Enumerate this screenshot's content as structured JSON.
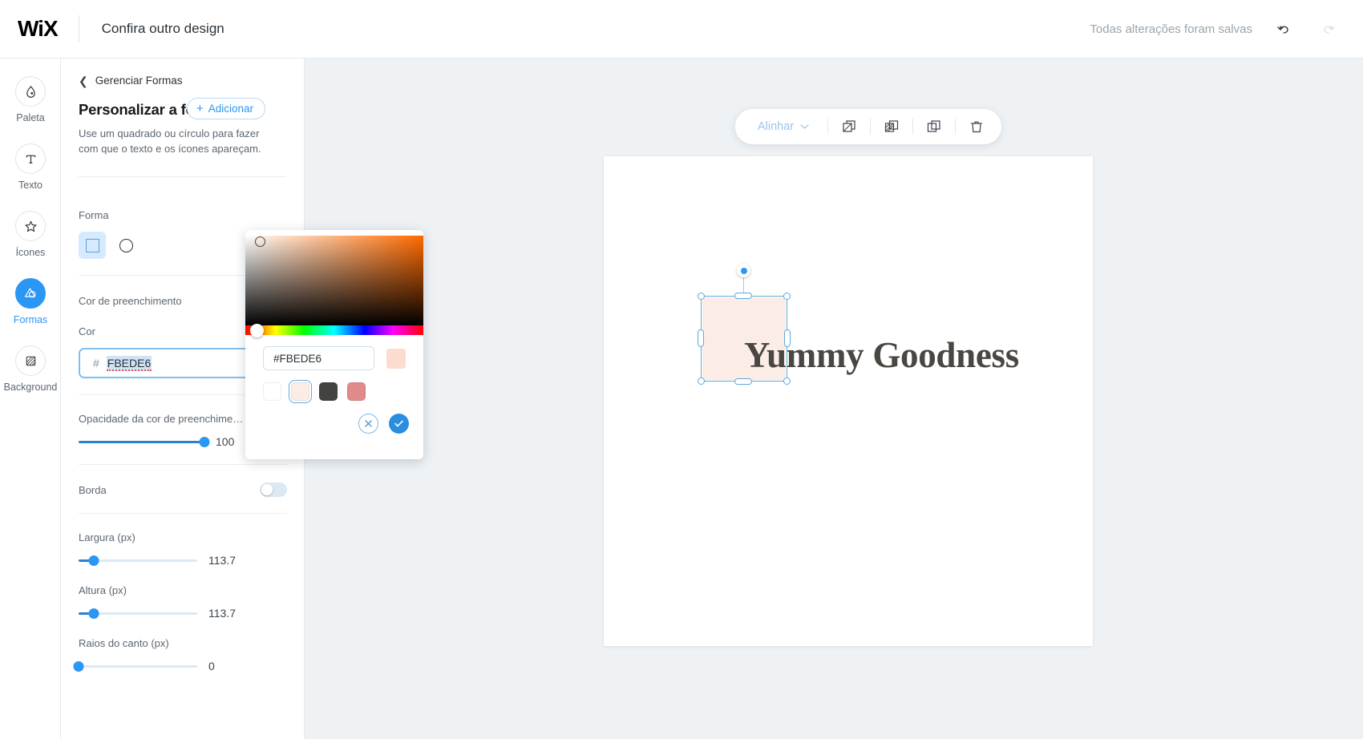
{
  "topbar": {
    "logo": "WiX",
    "title": "Confira outro design",
    "saved_status": "Todas alterações foram salvas",
    "undo_icon": "undo-icon",
    "redo_icon": "redo-icon"
  },
  "rail": {
    "items": [
      {
        "label": "Paleta",
        "icon": "droplet-icon",
        "active": false
      },
      {
        "label": "Texto",
        "icon": "text-t-icon",
        "active": false
      },
      {
        "label": "Ícones",
        "icon": "star-icon",
        "active": false
      },
      {
        "label": "Formas",
        "icon": "shapes-icon",
        "active": true
      },
      {
        "label": "Background",
        "icon": "hatched-square-icon",
        "active": false
      }
    ]
  },
  "panel": {
    "back_label": "Gerenciar Formas",
    "back_icon": "chevron-left-icon",
    "title": "Personalizar a forma",
    "add_label": "Adicionar",
    "add_icon": "plus-icon",
    "description": "Use um quadrado ou círculo para fazer com que o texto e os ícones apareçam.",
    "shape": {
      "label": "Forma",
      "options": [
        {
          "name": "square",
          "icon": "square-icon",
          "selected": true
        },
        {
          "name": "circle",
          "icon": "circle-icon",
          "selected": false
        }
      ]
    },
    "fill_toggle": {
      "label": "Cor de preenchimento",
      "state": "on"
    },
    "color": {
      "label": "Cor",
      "hash": "#",
      "value": "FBEDE6",
      "swatch_hex": "#FBEDE6"
    },
    "opacity": {
      "label": "Opacidade da cor de preenchime…",
      "value": "100",
      "percent": 100
    },
    "border_toggle": {
      "label": "Borda",
      "state": "off"
    },
    "width": {
      "label": "Largura (px)",
      "value": "113.7",
      "percent": 12
    },
    "height": {
      "label": "Altura (px)",
      "value": "113.7",
      "percent": 12
    },
    "corner_radius": {
      "label": "Raios do canto (px)",
      "value": "0",
      "percent": 0
    }
  },
  "picker": {
    "hex_value": "#FBEDE6",
    "preview_hex": "#FBDCCF",
    "swatches": [
      {
        "name": "white",
        "hex": "#FFFFFF",
        "selected": false
      },
      {
        "name": "peach",
        "hex": "#FBEDE6",
        "selected": true
      },
      {
        "name": "dark-gray",
        "hex": "#434341",
        "selected": false
      },
      {
        "name": "rose",
        "hex": "#E08A8A",
        "selected": false
      }
    ],
    "cancel_icon": "close-icon",
    "confirm_icon": "check-icon"
  },
  "toolbar": {
    "align_label": "Alinhar",
    "align_caret": "chevron-down-icon",
    "items": [
      {
        "name": "bring-forward-icon"
      },
      {
        "name": "mask-overlay-icon"
      },
      {
        "name": "duplicate-icon"
      },
      {
        "name": "delete-icon"
      }
    ]
  },
  "canvas": {
    "design_text": "Yummy Goodness",
    "shape_fill": "#FBEDE6",
    "selection_color": "#5FA8DE"
  }
}
